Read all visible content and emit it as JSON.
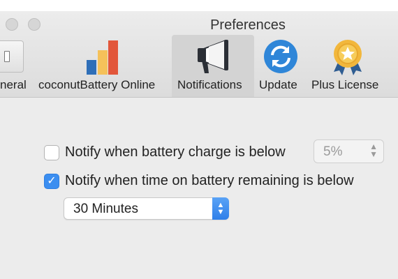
{
  "window": {
    "title": "Preferences"
  },
  "tabs": [
    {
      "label": "neral",
      "icon": "general-switch-icon"
    },
    {
      "label": "coconutBattery Online",
      "icon": "bar-chart-icon"
    },
    {
      "label": "Notifications",
      "icon": "megaphone-icon",
      "active": true
    },
    {
      "label": "Update",
      "icon": "refresh-icon"
    },
    {
      "label": "Plus License",
      "icon": "award-ribbon-icon"
    }
  ],
  "settings": {
    "charge_label": "Notify when battery charge is below",
    "charge_checked": false,
    "charge_value": "5%",
    "time_label": "Notify when time on battery remaining is below",
    "time_checked": true,
    "time_value": "30 Minutes"
  },
  "colors": {
    "accent": "#3b8ef0",
    "chart_blue": "#2f6fb8",
    "chart_yellow": "#f5c15a",
    "chart_orange": "#e2563a",
    "refresh_blue": "#2f86d8",
    "award_gold": "#f2b73c",
    "award_ribbon": "#2f5d92"
  }
}
